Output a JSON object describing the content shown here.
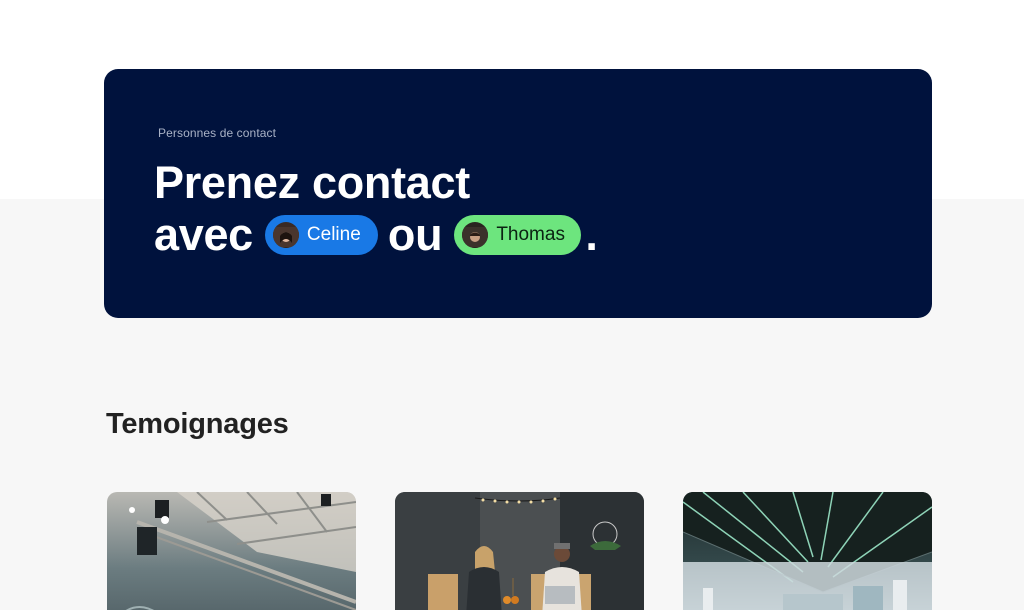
{
  "hero": {
    "eyebrow": "Personnes de contact",
    "line1": "Prenez contact",
    "line2_prefix": "avec",
    "connector": "ou",
    "end_punct": ".",
    "contacts": [
      {
        "name": "Celine",
        "color": "#1979e6"
      },
      {
        "name": "Thomas",
        "color": "#6de57e"
      }
    ],
    "background": "#00123d"
  },
  "testimonials": {
    "title": "Temoignages"
  }
}
